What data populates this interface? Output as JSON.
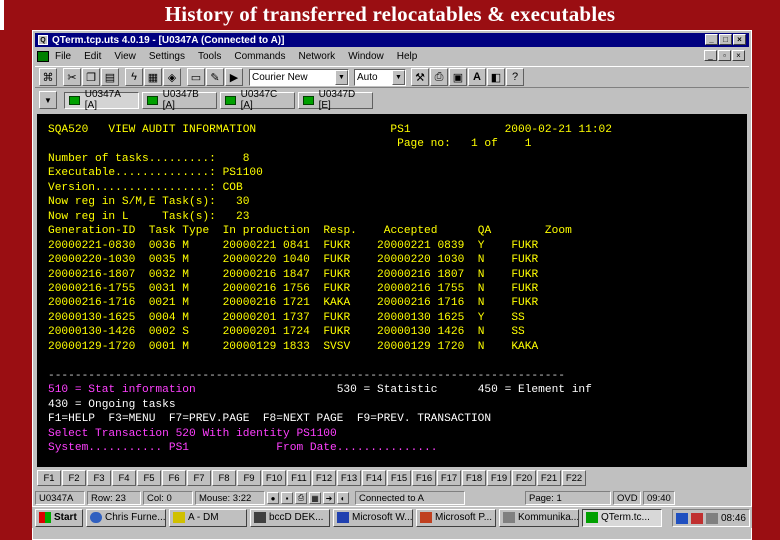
{
  "slide": {
    "title": "History of transferred relocatables & executables"
  },
  "window": {
    "title": "QTerm.tcp.uts 4.0.19 - [U0347A (Connected to A)]",
    "controls": [
      "_",
      "□",
      "×"
    ]
  },
  "menu": [
    "File",
    "Edit",
    "View",
    "Settings",
    "Tools",
    "Commands",
    "Network",
    "Window",
    "Help"
  ],
  "toolbar": {
    "font_combo": "Courier New",
    "size_combo": "Auto"
  },
  "sessions": [
    "U0347A [A]",
    "U0347B [A]",
    "U0347C [A]",
    "U0347D [E]"
  ],
  "terminal": {
    "header_left": "SQA520   VIEW AUDIT INFORMATION",
    "header_mid": "PS1",
    "header_date": "2000-02-21 11:02",
    "page_label": "Page no:",
    "page_no": "1",
    "page_of": "of",
    "page_total": "1",
    "fields": [
      {
        "label": "Number of tasks.........:",
        "value": "8"
      },
      {
        "label": "Executable..............:",
        "value": "PS1100"
      },
      {
        "label": "Version.................:",
        "value": "COB"
      },
      {
        "label": "Now reg in S/M,E Task(s):",
        "value": "30"
      },
      {
        "label": "Now reg in L     Task(s):",
        "value": "23"
      }
    ],
    "columns": [
      "Generation-ID",
      "Task",
      "Type",
      "In production",
      "Resp.",
      "Accepted",
      "QA",
      "Zoom"
    ],
    "rows": [
      [
        "20000221-0830",
        "0036",
        "M",
        "20000221 0841",
        "FUKR",
        "20000221 0839",
        "Y",
        "FUKR"
      ],
      [
        "20000220-1030",
        "0035",
        "M",
        "20000220 1040",
        "FUKR",
        "20000220 1030",
        "N",
        "FUKR"
      ],
      [
        "20000216-1807",
        "0032",
        "M",
        "20000216 1847",
        "FUKR",
        "20000216 1807",
        "N",
        "FUKR"
      ],
      [
        "20000216-1755",
        "0031",
        "M",
        "20000216 1756",
        "FUKR",
        "20000216 1755",
        "N",
        "FUKR"
      ],
      [
        "20000216-1716",
        "0021",
        "M",
        "20000216 1721",
        "KAKA",
        "20000216 1716",
        "N",
        "FUKR"
      ],
      [
        "20000130-1625",
        "0004",
        "M",
        "20000201 1737",
        "FUKR",
        "20000130 1625",
        "Y",
        "SS"
      ],
      [
        "20000130-1426",
        "0002",
        "S",
        "20000201 1724",
        "FUKR",
        "20000130 1426",
        "N",
        "SS"
      ],
      [
        "20000129-1720",
        "0001",
        "M",
        "20000129 1833",
        "SVSV",
        "20000129 1720",
        "N",
        "KAKA"
      ]
    ],
    "separator": "-----------------------------------------------------------------------------",
    "opt1": "510 = Stat information",
    "opt2": "530 = Statistic",
    "opt3": "450 = Element inf",
    "opt4": "430 = Ongoing tasks",
    "fkeys_line": "F1=HELP  F3=MENU  F7=PREV.PAGE  F8=NEXT PAGE  F9=PREV. TRANSACTION",
    "select_label": "Select Transaction",
    "select_code": "520",
    "with_label": "With identity",
    "with_value": "PS1100",
    "system_label": "System...........",
    "system_value": "PS1",
    "from_label": "From Date...............",
    "colors": {
      "yellow": "#ffff00",
      "magenta": "#ff40ff",
      "white": "#ffffff",
      "background": "#000000"
    }
  },
  "fkeys": [
    "F1",
    "F2",
    "F3",
    "F4",
    "F5",
    "F6",
    "F7",
    "F8",
    "F9",
    "F10",
    "F11",
    "F12",
    "F13",
    "F14",
    "F15",
    "F16",
    "F17",
    "F18",
    "F19",
    "F20",
    "F21",
    "F22"
  ],
  "status": {
    "session": "U0347A",
    "row": "Row: 23",
    "col": "Col: 0",
    "mouse": "Mouse: 3:22",
    "connected": "Connected to A",
    "page": "Page: 1",
    "ovd": "OVD",
    "time": "09:40"
  },
  "taskbar": {
    "start": "Start",
    "tasks": [
      "Chris Furne...",
      "A - DM",
      "bccD DEK...",
      "Microsoft W...",
      "Microsoft P...",
      "Kommunika...",
      "QTerm.tc..."
    ],
    "clock": "08:46"
  }
}
